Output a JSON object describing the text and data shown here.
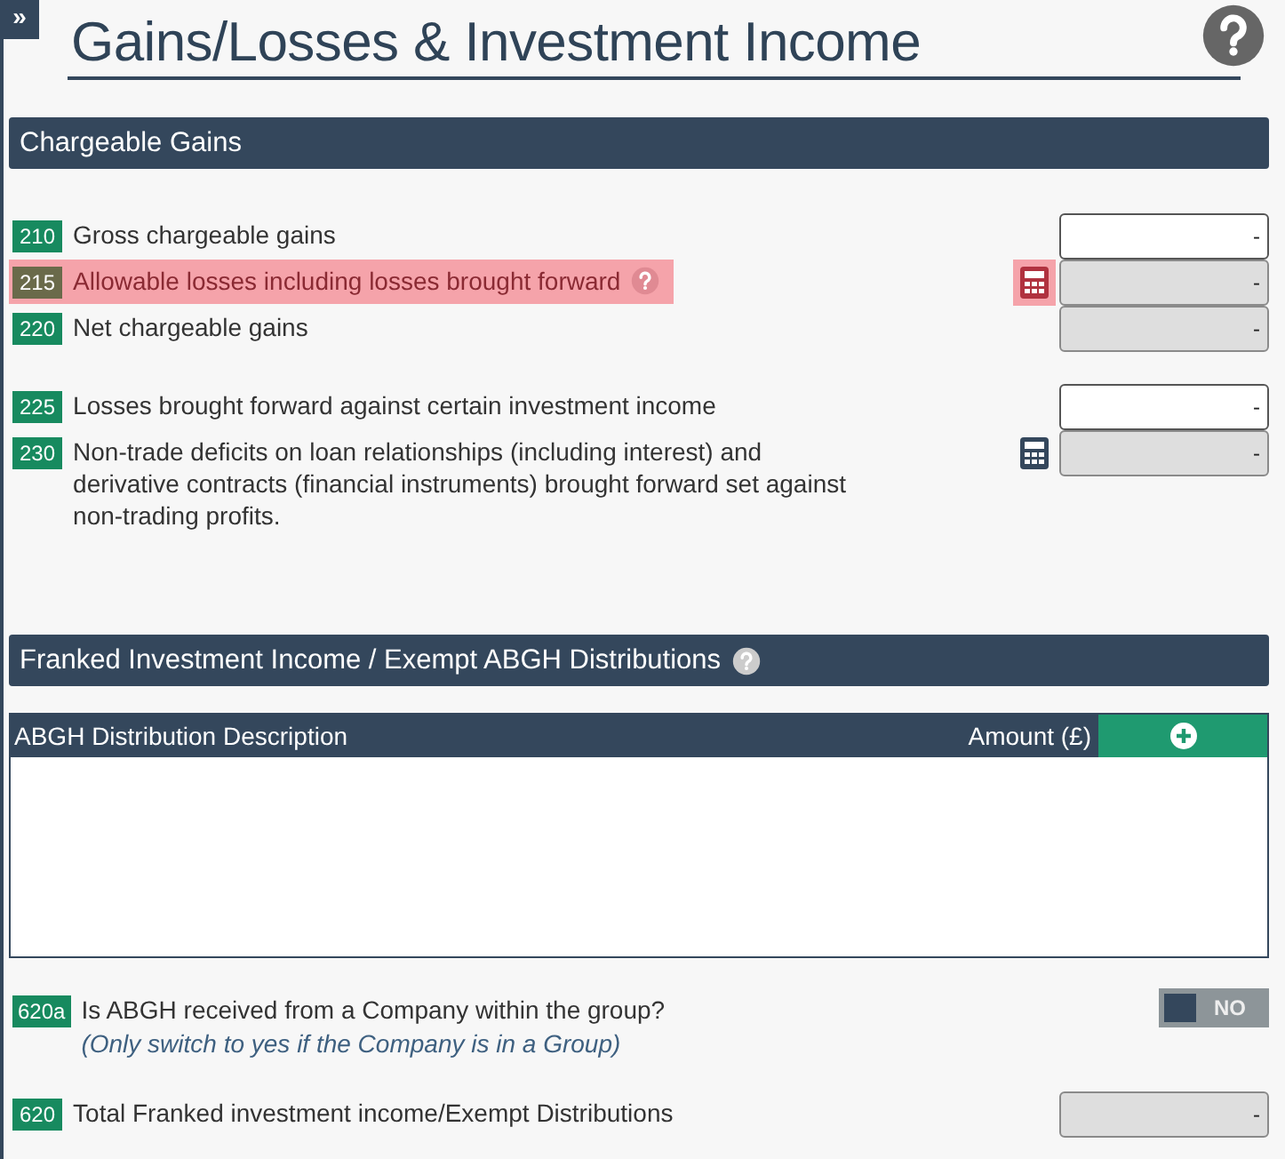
{
  "sidebar_toggle": "»",
  "title": "Gains/Losses & Investment Income",
  "chargeable_gains": {
    "title": "Chargeable Gains",
    "help": false,
    "rows": [
      {
        "kind": "field",
        "code": "210",
        "label": "Gross chargeable gains",
        "value": "-",
        "editable": true,
        "calculator": false,
        "highlighted": false,
        "help": false,
        "spaced": false
      },
      {
        "kind": "field",
        "code": "215",
        "label": "Allowable losses including losses brought forward",
        "value": "-",
        "editable": false,
        "calculator": true,
        "highlighted": true,
        "help": true,
        "spaced": false
      },
      {
        "kind": "field",
        "code": "220",
        "label": "Net chargeable gains",
        "value": "-",
        "editable": false,
        "calculator": false,
        "highlighted": false,
        "help": false,
        "spaced": false
      },
      {
        "kind": "field",
        "code": "225",
        "label": "Losses brought forward against certain investment income",
        "value": "-",
        "editable": true,
        "calculator": false,
        "highlighted": false,
        "help": false,
        "spaced": true
      },
      {
        "kind": "field",
        "code": "230",
        "label": "Non-trade deficits on loan relationships (including interest) and derivative contracts (financial instruments) brought forward set against non-trading profits.",
        "value": "-",
        "editable": false,
        "calculator": true,
        "highlighted": false,
        "help": false,
        "spaced": false
      }
    ]
  },
  "franked_income": {
    "title": "Franked Investment Income / Exempt ABGH Distributions",
    "help": true,
    "table": {
      "columns": [
        "ABGH Distribution Description",
        "Amount (£)"
      ]
    },
    "rows": [
      {
        "kind": "toggle",
        "code": "620a",
        "label": "Is ABGH received from a Company within the group?",
        "note": "(Only switch to yes if the Company is in a Group)",
        "toggle": {
          "on": false,
          "label": "NO"
        }
      },
      {
        "kind": "field",
        "code": "620",
        "label": "Total Franked investment income/Exempt Distributions",
        "value": "-",
        "editable": false,
        "calculator": false,
        "highlighted": false,
        "help": false,
        "spaced": false
      }
    ]
  }
}
